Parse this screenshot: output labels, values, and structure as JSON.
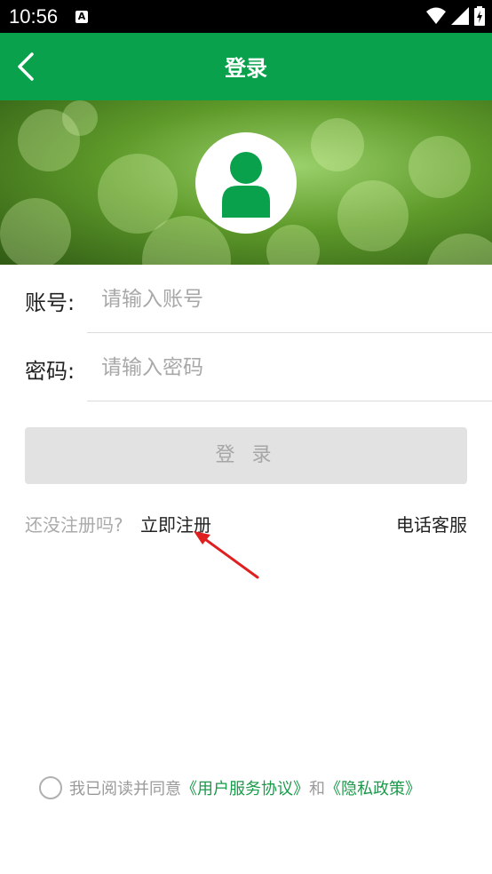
{
  "status_bar": {
    "time": "10:56",
    "notification_letter": "A"
  },
  "header": {
    "title": "登录"
  },
  "form": {
    "account_label": "账号:",
    "account_placeholder": "请输入账号",
    "password_label": "密码:",
    "password_placeholder": "请输入密码"
  },
  "login_button": "登 录",
  "register": {
    "hint": "还没注册吗?",
    "link": "立即注册"
  },
  "service": "电话客服",
  "agreement": {
    "prefix": "我已阅读并同意",
    "user_agreement": "《用户服务协议》",
    "and": "和",
    "privacy": "《隐私政策》"
  },
  "colors": {
    "brand_green": "#0aa14c",
    "link_green": "#1a9a4a",
    "annotation_red": "#e02020"
  }
}
